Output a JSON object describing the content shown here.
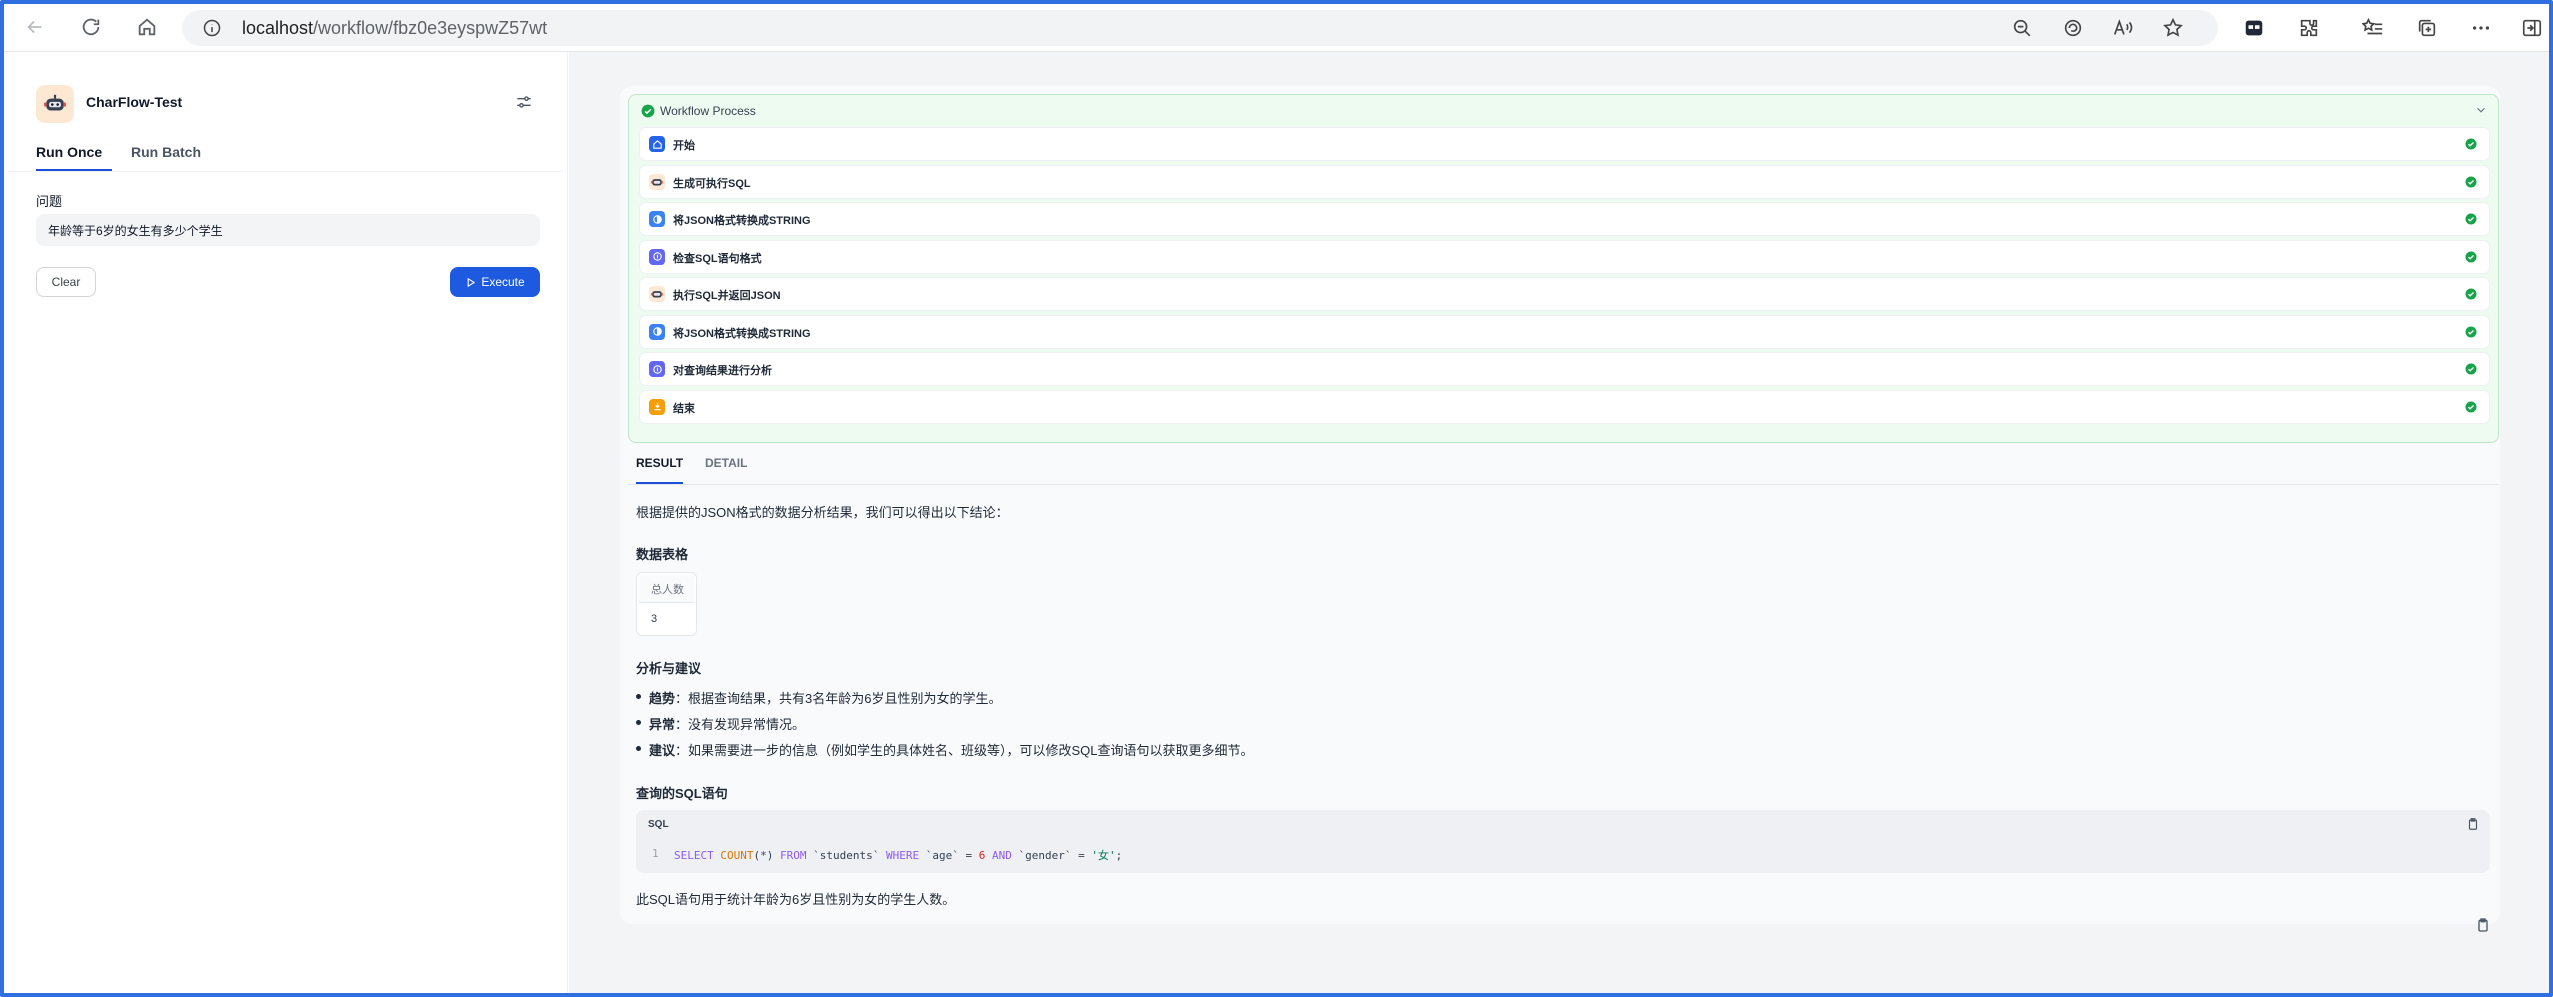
{
  "browser": {
    "url_host": "localhost",
    "url_path": "/workflow/fbz0e3eyspwZ57wt"
  },
  "app": {
    "title": "CharFlow-Test",
    "tabs": [
      "Run Once",
      "Run Batch"
    ],
    "active_tab": "Run Once"
  },
  "form": {
    "field_label": "问题",
    "field_value": "年龄等于6岁的女生有多少个学生",
    "clear_label": "Clear",
    "execute_label": "Execute"
  },
  "workflow": {
    "title": "Workflow Process",
    "steps": [
      {
        "label": "开始",
        "icon": "home-icon",
        "color": "#2563eb"
      },
      {
        "label": "生成可执行SQL",
        "icon": "robot-icon",
        "color": "#f97316"
      },
      {
        "label": "将JSON格式转换成STRING",
        "icon": "code-icon",
        "color": "#3b82f6"
      },
      {
        "label": "检查SQL语句格式",
        "icon": "check-format-icon",
        "color": "#6366f1"
      },
      {
        "label": "执行SQL并返回JSON",
        "icon": "robot-icon",
        "color": "#f97316"
      },
      {
        "label": "将JSON格式转换成STRING",
        "icon": "code-icon",
        "color": "#3b82f6"
      },
      {
        "label": "对查询结果进行分析",
        "icon": "analysis-icon",
        "color": "#6366f1"
      },
      {
        "label": "结束",
        "icon": "end-icon",
        "color": "#f59e0b"
      }
    ]
  },
  "result_tabs": [
    "RESULT",
    "DETAIL"
  ],
  "result": {
    "intro": "根据提供的JSON格式的数据分析结果，我们可以得出以下结论：",
    "table_heading": "数据表格",
    "table": {
      "headers": [
        "总人数"
      ],
      "rows": [
        [
          "3"
        ]
      ]
    },
    "analysis_heading": "分析与建议",
    "bullets": [
      {
        "term": "趋势",
        "text": "：根据查询结果，共有3名年龄为6岁且性别为女的学生。"
      },
      {
        "term": "异常",
        "text": "：没有发现异常情况。"
      },
      {
        "term": "建议",
        "text": "：如果需要进一步的信息（例如学生的具体姓名、班级等），可以修改SQL查询语句以获取更多细节。"
      }
    ],
    "sql_heading": "查询的SQL语句",
    "code_lang": "SQL",
    "code_line_number": "1",
    "sql_parts": {
      "select": "SELECT",
      "count": "COUNT",
      "args": "(*)",
      "from": "FROM",
      "table": "`students`",
      "where": "WHERE",
      "col_age": "`age`",
      "eq1": "=",
      "age_val": "6",
      "and": "AND",
      "col_gender": "`gender`",
      "eq2": "=",
      "gender_val": "'女'",
      "end": ";"
    },
    "footer": "此SQL语句用于统计年龄为6岁且性别为女的学生人数。"
  },
  "colors": {
    "accent": "#1d5ae0",
    "success": "#16a34a",
    "workflow_bg": "#eefbf1"
  }
}
